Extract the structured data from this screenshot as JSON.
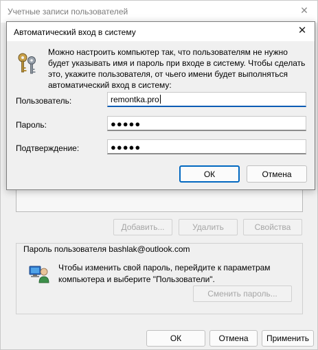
{
  "background_window": {
    "title": "Учетные записи пользователей",
    "buttons": {
      "add": "Добавить...",
      "remove": "Удалить",
      "properties": "Свойства"
    },
    "password_group": {
      "label": "Пароль пользователя bashlak@outlook.com",
      "text": "Чтобы изменить свой пароль, перейдите к параметрам компьютера и выберите \"Пользователи\".",
      "change_password_button": "Сменить пароль..."
    },
    "bottom_buttons": {
      "ok": "ОК",
      "cancel": "Отмена",
      "apply": "Применить"
    }
  },
  "dialog": {
    "title": "Автоматический вход в систему",
    "description": "Можно настроить компьютер так, что пользователям не нужно будет указывать имя и пароль при входе в систему. Чтобы сделать это, укажите пользователя, от чьего имени будет выполняться автоматический вход в систему:",
    "fields": {
      "user_label": "Пользователь:",
      "user_value": "remontka.pro",
      "password_label": "Пароль:",
      "password_value": "●●●●●",
      "confirm_label": "Подтверждение:",
      "confirm_value": "●●●●●"
    },
    "buttons": {
      "ok": "ОК",
      "cancel": "Отмена"
    }
  },
  "icons": {
    "dialog_icon": "keys-icon",
    "user_icon": "user-computer-icon",
    "close_icon": "close-icon"
  },
  "colors": {
    "accent": "#0067c0",
    "focus_underline": "#0a5bb4",
    "disabled_text": "#a6a6a6"
  }
}
